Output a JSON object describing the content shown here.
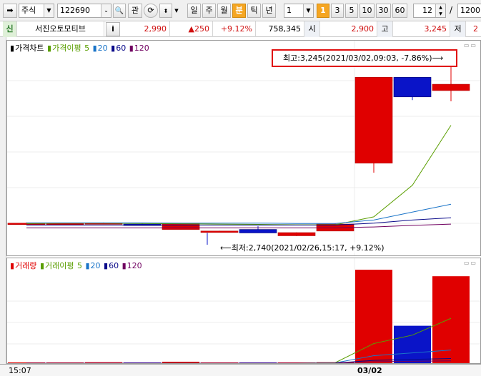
{
  "toolbar": {
    "market_select": "주식",
    "code_value": "122690",
    "search_glyph": "🔍",
    "watch_label": "관",
    "period_buttons": [
      "일",
      "주",
      "월",
      "분",
      "틱",
      "년"
    ],
    "active_period": "분",
    "interval_select": "1",
    "interval_buttons": [
      "1",
      "3",
      "5",
      "10",
      "30",
      "60"
    ],
    "active_interval": "1",
    "count_value": "12",
    "slash": "/",
    "total_value": "1200"
  },
  "info": {
    "credit_badge": "신",
    "stock_name": "서진오토모티브",
    "info_button": "i",
    "price": "2,990",
    "change": "▲250",
    "change_rate": "+9.12%",
    "volume": "758,345",
    "open_label": "시",
    "open": "2,900",
    "high_label": "고",
    "high": "3,245",
    "low_label": "저",
    "low": "2"
  },
  "price_legend": {
    "chart_name": "가격차트",
    "ma_name": "가격이평",
    "periods": [
      "5",
      "20",
      "60",
      "120"
    ]
  },
  "volume_legend": {
    "chart_name": "거래량",
    "ma_name": "거래이평",
    "periods": [
      "5",
      "20",
      "60",
      "120"
    ]
  },
  "annotations": {
    "high": "최고:3,245(2021/03/02,09:03, -7.86%)⟶",
    "low": "⟵최저:2,740(2021/02/26,15:17, +9.12%)"
  },
  "x_axis": {
    "labels": [
      "15:07",
      "03/02"
    ]
  },
  "colors": {
    "up": "#e00000",
    "down": "#0a14c8",
    "ma5": "#5a9e00",
    "ma20": "#1a74c8",
    "ma60": "#0a0a8a",
    "ma120": "#700060",
    "accent": "#f5a623"
  },
  "chart_data": [
    {
      "type": "candlestick",
      "series": [
        {
          "name": "가격차트",
          "values": [
            {
              "x": 1,
              "open": 2740,
              "high": 2742,
              "low": 2738,
              "close": 2740
            },
            {
              "x": 2,
              "open": 2740,
              "high": 2741,
              "low": 2739,
              "close": 2740
            },
            {
              "x": 3,
              "open": 2740,
              "high": 2742,
              "low": 2738,
              "close": 2741
            },
            {
              "x": 4,
              "open": 2737,
              "high": 2738,
              "low": 2735,
              "close": 2735
            },
            {
              "x": 5,
              "open": 2720,
              "high": 2741,
              "low": 2720,
              "close": 2740
            },
            {
              "x": 6,
              "open": 2715,
              "high": 2716,
              "low": 2714,
              "close": 2715
            },
            {
              "x": 7,
              "open": 2720,
              "high": 2730,
              "low": 2709,
              "close": 2709
            },
            {
              "x": 8,
              "open": 2700,
              "high": 2711,
              "low": 2699,
              "close": 2710
            },
            {
              "x": 9,
              "open": 2715,
              "high": 2738,
              "low": 2715,
              "close": 2737
            },
            {
              "x": 10,
              "open": 2930,
              "high": 3202,
              "low": 2900,
              "close": 3202
            },
            {
              "x": 11,
              "open": 3202,
              "high": 3202,
              "low": 3130,
              "close": 3140
            },
            {
              "x": 12,
              "open": 3160,
              "high": 3245,
              "low": 3126,
              "close": 3180
            }
          ]
        },
        {
          "name": "5",
          "values": [
            2739,
            2740,
            2740,
            2739,
            2738,
            2737,
            2736,
            2735,
            2735,
            2760,
            2860,
            3050
          ]
        },
        {
          "name": "20",
          "values": [
            2741,
            2741,
            2741,
            2741,
            2740,
            2740,
            2740,
            2739,
            2739,
            2750,
            2775,
            2800
          ]
        },
        {
          "name": "60",
          "values": [
            2734,
            2734,
            2734,
            2734,
            2734,
            2734,
            2734,
            2734,
            2734,
            2740,
            2750,
            2757
          ]
        },
        {
          "name": "120",
          "values": [
            2725,
            2725,
            2725,
            2725,
            2725,
            2725,
            2725,
            2725,
            2725,
            2728,
            2733,
            2737
          ]
        }
      ],
      "annotations": {
        "high": "최고:3,245(2021/03/02,09:03, -7.86%)",
        "low": "최저:2,740(2021/02/26,15:17, +9.12%)"
      },
      "ylim": [
        2640,
        3300
      ],
      "grid": true
    },
    {
      "type": "bar",
      "series": [
        {
          "name": "거래량",
          "values": [
            0,
            0,
            1,
            0,
            1.5,
            0,
            0,
            0,
            1,
            100,
            40,
            93
          ]
        },
        {
          "name": "5",
          "values": [
            0,
            0,
            0,
            0,
            0,
            0,
            0,
            0,
            0.5,
            21,
            30,
            48
          ]
        },
        {
          "name": "20",
          "values": [
            0,
            0,
            0,
            0,
            0,
            0,
            0,
            0,
            0.3,
            8,
            11,
            14
          ]
        },
        {
          "name": "60",
          "values": [
            0,
            0,
            0,
            0,
            0,
            0,
            0,
            0,
            0.1,
            3,
            4,
            5
          ]
        },
        {
          "name": "120",
          "values": [
            0,
            0,
            0,
            0,
            0,
            0,
            0,
            0,
            0.05,
            1.5,
            2,
            2.5
          ]
        }
      ],
      "ylim": [
        0,
        100
      ],
      "grid": true
    }
  ]
}
